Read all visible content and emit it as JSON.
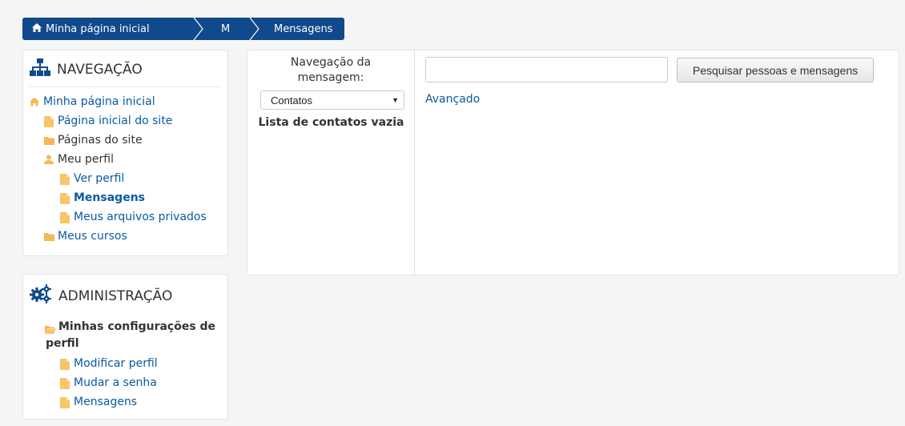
{
  "breadcrumb": {
    "home": "Minha página inicial",
    "course": "M",
    "current": "Mensagens"
  },
  "navigation": {
    "title": "NAVEGAÇÃO",
    "items": [
      {
        "label": "Minha página inicial"
      },
      {
        "label": "Página inicial do site"
      },
      {
        "label": "Páginas do site"
      },
      {
        "label": "Meu perfil"
      },
      {
        "label": "Ver perfil"
      },
      {
        "label": "Mensagens"
      },
      {
        "label": "Meus arquivos privados"
      },
      {
        "label": "Meus cursos"
      }
    ]
  },
  "administration": {
    "title": "ADMINISTRAÇÃO",
    "section": "Minhas configurações de perfil",
    "items": [
      {
        "label": "Modificar perfil"
      },
      {
        "label": "Mudar a senha"
      },
      {
        "label": "Mensagens"
      }
    ]
  },
  "messages": {
    "nav_label": "Navegação da mensagem:",
    "select_value": "Contatos",
    "empty_text": "Lista de contatos vazia",
    "search_value": "",
    "search_button": "Pesquisar pessoas e mensagens",
    "advanced_link": "Avançado"
  },
  "colors": {
    "breadcrumb_bg": "#104a8c",
    "link": "#0a5aa0",
    "folder_icon": "#f5b75a",
    "page_icon": "#f7c66a"
  },
  "icons": {
    "home": "home-icon",
    "sitemap": "sitemap-icon",
    "cogs": "cogs-icon",
    "folder": "folder-icon",
    "page": "page-icon",
    "user": "user-icon"
  }
}
